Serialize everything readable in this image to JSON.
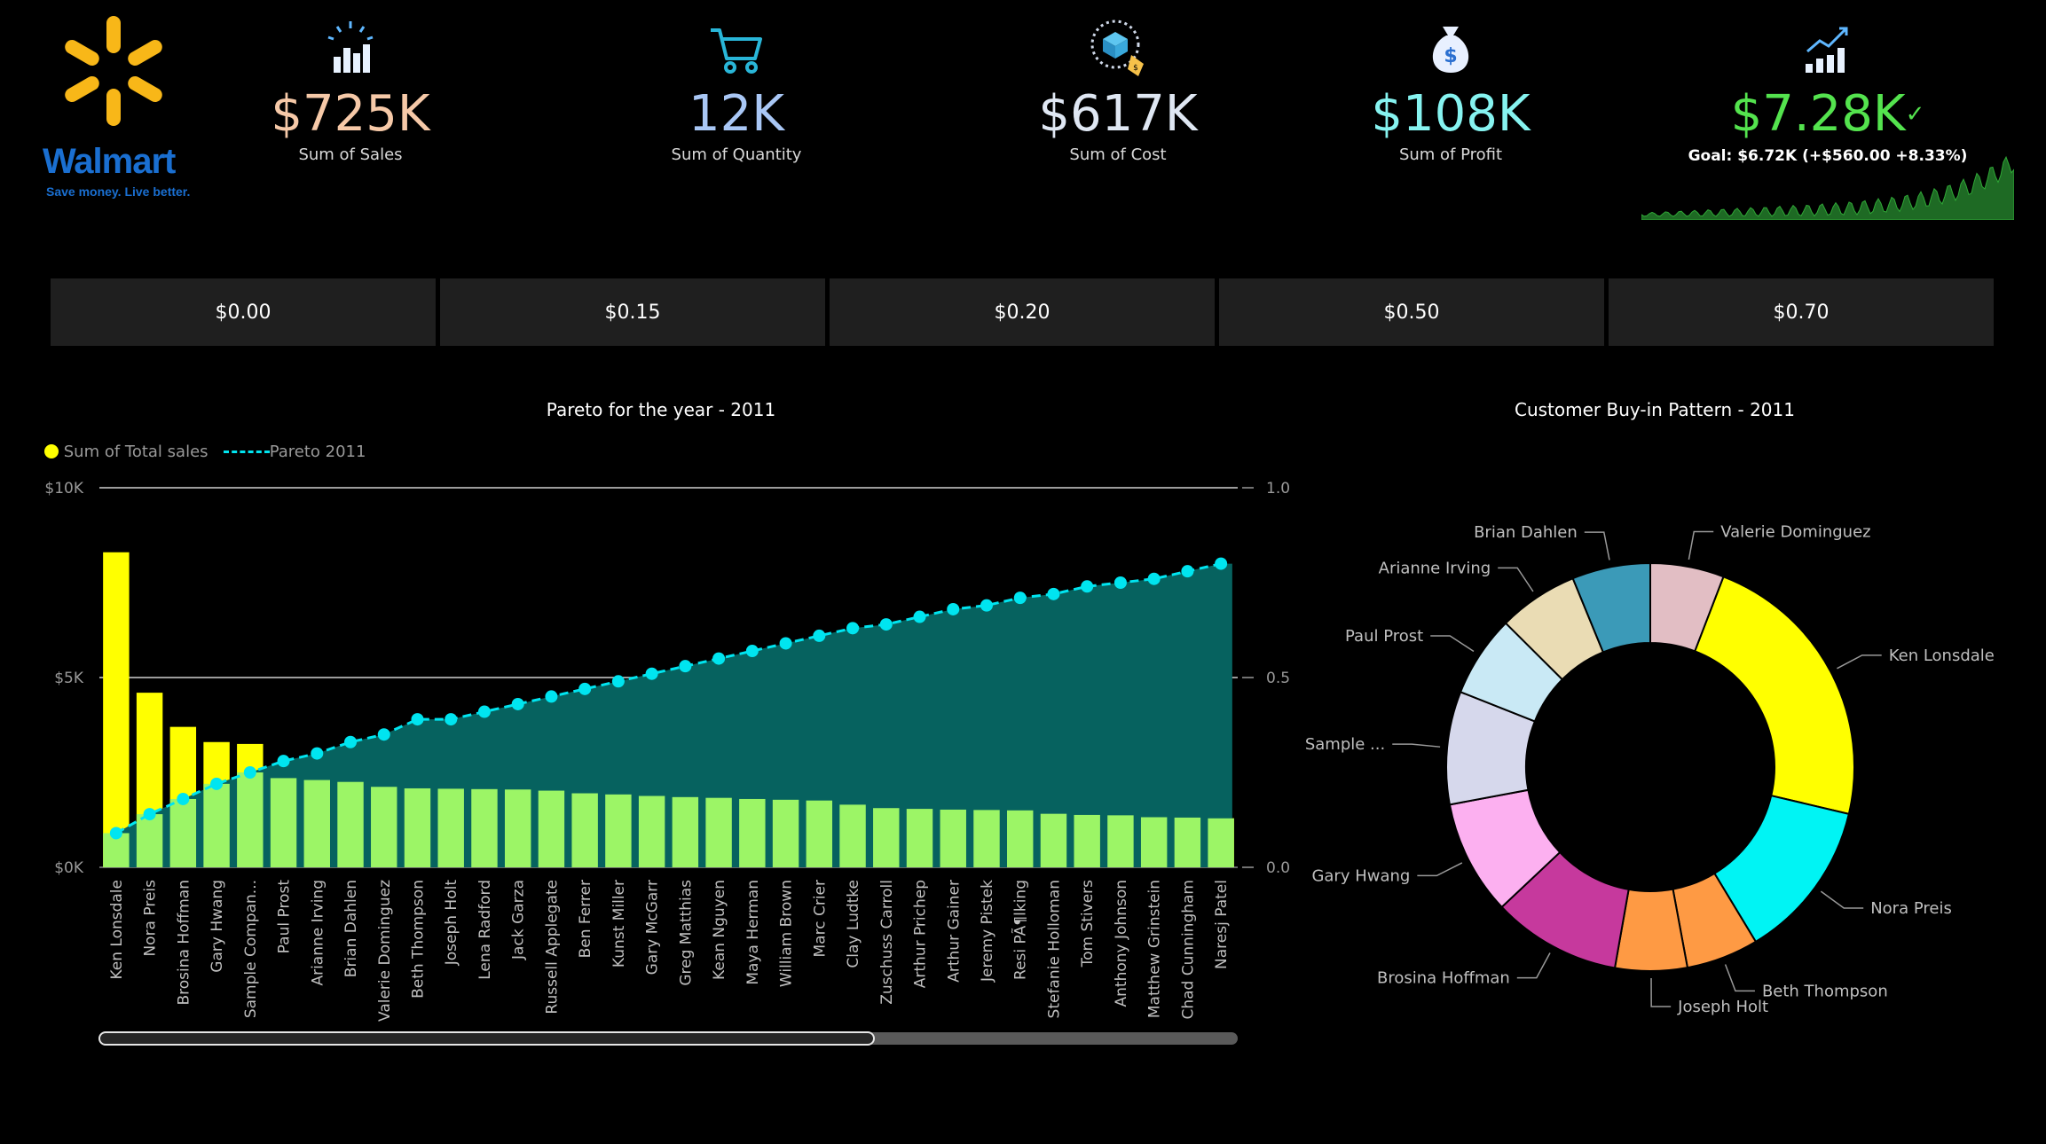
{
  "logo": {
    "word": "Walmart",
    "tagline": "Save money. Live better."
  },
  "kpis": [
    {
      "icon": "bar-chart-sparkle-icon",
      "value": "$725K",
      "label": "Sum of Sales",
      "color": "#f6c9a8"
    },
    {
      "icon": "shopping-cart-icon",
      "value": "12K",
      "label": "Sum of Quantity",
      "color": "#a9c7f5"
    },
    {
      "icon": "price-tag-box-icon",
      "value": "$617K",
      "label": "Sum of Cost",
      "color": "#dfe7f3"
    },
    {
      "icon": "money-bag-icon",
      "value": "$108K",
      "label": "Sum of Profit",
      "color": "#86f3f0"
    }
  ],
  "goal_card": {
    "icon": "growth-chart-icon",
    "value": "$7.28K",
    "check": "✓",
    "goal": "Goal: $6.72K (+$560.00 +8.33%)",
    "color": "#54e34e"
  },
  "slicers": [
    "$0.00",
    "$0.15",
    "$0.20",
    "$0.50",
    "$0.70"
  ],
  "chart_data": [
    {
      "type": "bar",
      "title": "Pareto for the year - 2011",
      "legend": [
        "Sum of  Total sales",
        "Pareto 2011"
      ],
      "y_ticks": [
        "$10K",
        "$5K",
        "$0K"
      ],
      "y2_ticks": [
        "1.0",
        "0.5",
        "0.0"
      ],
      "ylim": [
        0,
        10000
      ],
      "y2lim": [
        0,
        1
      ],
      "categories": [
        "Ken Lonsdale",
        "Nora Preis",
        "Brosina Hoffman",
        "Gary Hwang",
        "Sample Compan...",
        "Paul Prost",
        "Arianne Irving",
        "Brian Dahlen",
        "Valerie Dominguez",
        "Beth Thompson",
        "Joseph Holt",
        "Lena Radford",
        "Jack Garza",
        "Russell Applegate",
        "Ben Ferrer",
        "Kunst Miller",
        "Gary McGarr",
        "Greg Matthias",
        "Kean Nguyen",
        "Maya Herman",
        "William Brown",
        "Marc Crier",
        "Clay Ludtke",
        "Zuschuss Carroll",
        "Arthur Prichep",
        "Arthur Gainer",
        "Jeremy Pistek",
        "Resi PÃ¶lking",
        "Stefanie Holloman",
        "Tom Stivers",
        "Anthony Johnson",
        "Matthew Grinstein",
        "Chad Cunningham",
        "Naresj Patel"
      ],
      "series": [
        {
          "name": "Sum of  Total sales",
          "type": "bar",
          "values": [
            8300,
            4600,
            3700,
            3300,
            3250,
            2350,
            2300,
            2250,
            2120,
            2080,
            2070,
            2060,
            2050,
            2020,
            1950,
            1920,
            1880,
            1850,
            1830,
            1800,
            1780,
            1760,
            1650,
            1560,
            1540,
            1520,
            1510,
            1500,
            1410,
            1380,
            1370,
            1320,
            1310,
            1290
          ]
        },
        {
          "name": "Pareto 2011",
          "type": "line",
          "values": [
            0.09,
            0.14,
            0.18,
            0.22,
            0.25,
            0.28,
            0.3,
            0.33,
            0.35,
            0.39,
            0.39,
            0.41,
            0.43,
            0.45,
            0.47,
            0.49,
            0.51,
            0.53,
            0.55,
            0.57,
            0.59,
            0.61,
            0.63,
            0.64,
            0.66,
            0.68,
            0.69,
            0.71,
            0.72,
            0.74,
            0.75,
            0.76,
            0.78,
            0.8
          ]
        }
      ],
      "colors": {
        "bar_top": "#ffff00",
        "bar": "#9cf566",
        "line": "#00e5f0",
        "area": "#06625f"
      }
    },
    {
      "type": "pie",
      "title": "Customer Buy-in Pattern - 2011",
      "slices": [
        {
          "label": "Ken Lonsdale",
          "value": 8300,
          "color": "#ffff00"
        },
        {
          "label": "Nora Preis",
          "value": 4600,
          "color": "#00f4f4"
        },
        {
          "label": "Beth Thompson",
          "value": 2080,
          "color": "#fe9a44"
        },
        {
          "label": "Joseph Holt",
          "value": 2070,
          "color": "#fe9a44"
        },
        {
          "label": "Brosina Hoffman",
          "value": 3700,
          "color": "#c6399d"
        },
        {
          "label": "Gary Hwang",
          "value": 3300,
          "color": "#fcb0f0"
        },
        {
          "label": "Sample ...",
          "value": 3250,
          "color": "#d6d8ec"
        },
        {
          "label": "Paul Prost",
          "value": 2350,
          "color": "#c9e9f5"
        },
        {
          "label": "Arianne Irving",
          "value": 2300,
          "color": "#eadcb4"
        },
        {
          "label": "Brian Dahlen",
          "value": 2250,
          "color": "#3b9ab8"
        },
        {
          "label": "Valerie Dominguez",
          "value": 2120,
          "color": "#e2bec4"
        }
      ]
    }
  ]
}
